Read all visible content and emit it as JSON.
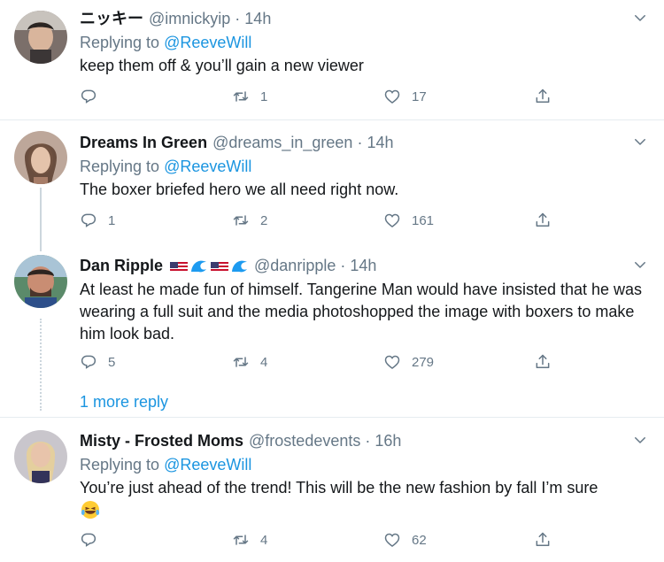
{
  "tweets": [
    {
      "name": "ニッキー",
      "handle": "@imnickyip",
      "sep": "·",
      "time": "14h",
      "replying_prefix": "Replying to",
      "replying_to": "@ReeveWill",
      "text": "keep them off & you’ll gain a new viewer",
      "reply_count": "",
      "retweet_count": "1",
      "like_count": "17"
    },
    {
      "name": "Dreams In Green",
      "handle": "@dreams_in_green",
      "sep": "·",
      "time": "14h",
      "replying_prefix": "Replying to",
      "replying_to": "@ReeveWill",
      "text": "The boxer briefed hero we all need right now.",
      "reply_count": "1",
      "retweet_count": "2",
      "like_count": "161"
    },
    {
      "name": "Dan Ripple",
      "handle": "@danripple",
      "sep": "·",
      "time": "14h",
      "text": "At least he made fun of himself. Tangerine Man would have insisted that he was wearing a full suit and the media photoshopped the image with boxers to make him look bad.",
      "reply_count": "5",
      "retweet_count": "4",
      "like_count": "279",
      "more_replies": "1 more reply"
    },
    {
      "name": "Misty - Frosted Moms",
      "handle": "@frostedevents",
      "sep": "·",
      "time": "16h",
      "replying_prefix": "Replying to",
      "replying_to": "@ReeveWill",
      "text": "You’re just ahead of the trend! This will be the new fashion by fall I’m sure",
      "reply_count": "",
      "retweet_count": "4",
      "like_count": "62"
    }
  ],
  "icons": {
    "reply": "reply-icon",
    "retweet": "retweet-icon",
    "like": "heart-icon",
    "share": "share-icon",
    "menu": "chevron-down-icon",
    "emoji": "tears-of-joy-emoji"
  },
  "colors": {
    "accent": "#1b95e0",
    "muted": "#657786",
    "text": "#14171a",
    "divider": "#e6ecf0"
  }
}
